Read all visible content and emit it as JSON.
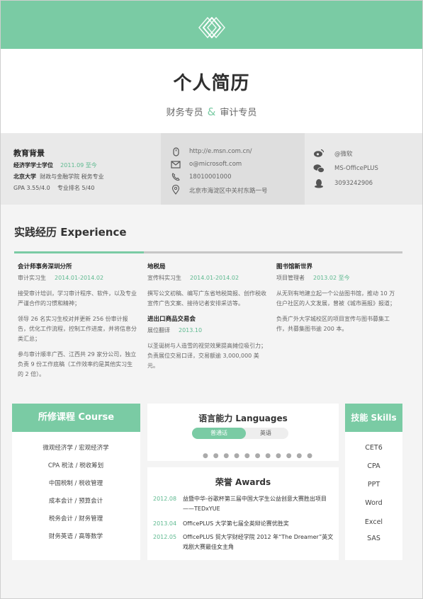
{
  "header": {
    "name": "个人简历",
    "role1": "财务专员",
    "amp": "&",
    "role2": "审计专员"
  },
  "education": {
    "title": "教育背景",
    "degree": "经济学学士学位",
    "period": "2011.09 至今",
    "school": "北京大学",
    "major": "财政与金融学院 税务专业",
    "gpa": "GPA 3.55/4.0",
    "rank": "专业排名 5/40"
  },
  "contact": {
    "website": "http://e.msn.com.cn/",
    "email": "o@microsoft.com",
    "phone": "18010001000",
    "address": "北京市海淀区中关村东路一号"
  },
  "social": {
    "weibo": "@微软",
    "wechat": "MS-OfficePLUS",
    "qq": "3093242906"
  },
  "experience": {
    "title": "实践经历 Experience",
    "col1": {
      "company": "会计师事务深圳分所",
      "role": "审计实习生",
      "period": "2014.01-2014.02",
      "p1": "接受审计培训，学习审计程序、软件，以及专业严谨合作的习惯和精神；",
      "p2": "领导 26 名实习生校对并更新 256 份审计报告，优化工作流程，控制工作进度，并将信息分类汇总；",
      "p3": "参与审计顺丰广西、江西共 29 家分公司，独立负责 9 份工作底稿（工作效率约是其他实习生的 2 倍）。"
    },
    "col2": {
      "company1": "地税局",
      "role1": "宣传科实习生",
      "period1": "2014.01-2014.02",
      "p1": "撰写公文初稿、编写广东省地税简报、创作税收宣传广告文案、接待记者安排采访等。",
      "company2": "进出口商品交易会",
      "role2": "展位翻译",
      "period2": "2013.10",
      "p2": "以圣诞树与人造雪的视觉效果提高摊位吸引力；负责展位交易口译，交易额逾 3,000,000 美元。"
    },
    "col3": {
      "company": "图书馆新世界",
      "role": "项目管理者",
      "period": "2013.02 至今",
      "p1": "从无到有地建立起一个公益图书馆，推动 10 万住户社区的人文发展，曾被《城市画报》报道；",
      "p2": "负责广外大学城校区的项目宣传与图书募集工作，共募集图书逾 200 本。"
    }
  },
  "courses": {
    "title": "所修课程  Course",
    "items": [
      "微观经济学 / 宏观经济学",
      "CPA 税法 / 税收筹划",
      "中国税制 / 税收管理",
      "成本会计 / 预算会计",
      "税务会计 / 财务管理",
      "财务英语 / 高等数学"
    ]
  },
  "languages": {
    "title": "语言能力 Languages",
    "opt1": "普通话",
    "opt2": "英语",
    "dots": "● ● ● ●  ●    ● ● ● ●  ●  ●"
  },
  "awards": {
    "title": "荣誉 Awards",
    "items": [
      {
        "year": "2012.08",
        "text": "益暨中华-谷歌杯第三届中国大学生公益创意大赛胜出项目——TEDxYUE"
      },
      {
        "year": "2013.04",
        "text": "OfficePLUS 大学第七届全英辩论赛优胜奖"
      },
      {
        "year": "2012.05",
        "text": "OfficePLUS 贸大学财经学院 2012 年“The Dreamer”英文戏剧大赛最佳女主角"
      }
    ]
  },
  "skills": {
    "title": "技能  Skills",
    "items": [
      "CET6",
      "CPA",
      "PPT",
      "Word",
      "Excel",
      "SAS"
    ]
  },
  "colors": {
    "accent": "#7acba4",
    "accent_text": "#5db98f"
  }
}
